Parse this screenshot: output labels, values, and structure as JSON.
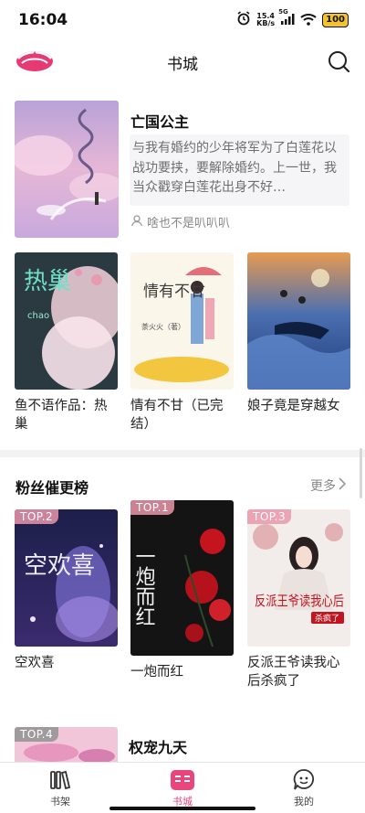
{
  "status": {
    "time": "16:04",
    "netspeed_value": "15.4",
    "netspeed_unit": "KB/s",
    "signal_label": "5G",
    "battery": "100"
  },
  "header": {
    "title": "书城",
    "logo_icon": "app-logo-icon",
    "search_icon": "search-icon"
  },
  "featured": {
    "title": "亡国公主",
    "description": "与我有婚约的少年将军为了白莲花以战功要挟，要解除婚约。上一世，我当众戳穿白莲花出身不好…",
    "author": "啥也不是叭叭叭"
  },
  "recommend_books": [
    {
      "title": "鱼不语作品：热巢",
      "cover_text": "热巢",
      "cover_sub": "chao"
    },
    {
      "title": "情有不甘（已完结）",
      "cover_text": "情有不甘",
      "cover_sub": "荼火火（著）"
    },
    {
      "title": "娘子竟是穿越女",
      "cover_text": "",
      "cover_sub": ""
    }
  ],
  "fans_section": {
    "title": "粉丝催更榜",
    "more_label": "更多"
  },
  "rank_books": [
    {
      "rank": "TOP.2",
      "title": "空欢喜",
      "cover_text": "空欢喜"
    },
    {
      "rank": "TOP.1",
      "title": "一炮而红",
      "cover_text": "一炮而红"
    },
    {
      "rank": "TOP.3",
      "title": "反派王爷读我心后杀疯了",
      "cover_text": "反派王爷读我心后",
      "cover_sub": "杀疯了"
    }
  ],
  "next_item": {
    "rank": "TOP.4",
    "title": "权宠九天"
  },
  "tabs": [
    {
      "label": "书架",
      "icon": "bookshelf-icon"
    },
    {
      "label": "书城",
      "icon": "bookstore-icon"
    },
    {
      "label": "我的",
      "icon": "profile-icon"
    }
  ],
  "colors": {
    "accent": "#e8467c",
    "badge": "#eb96aa"
  }
}
